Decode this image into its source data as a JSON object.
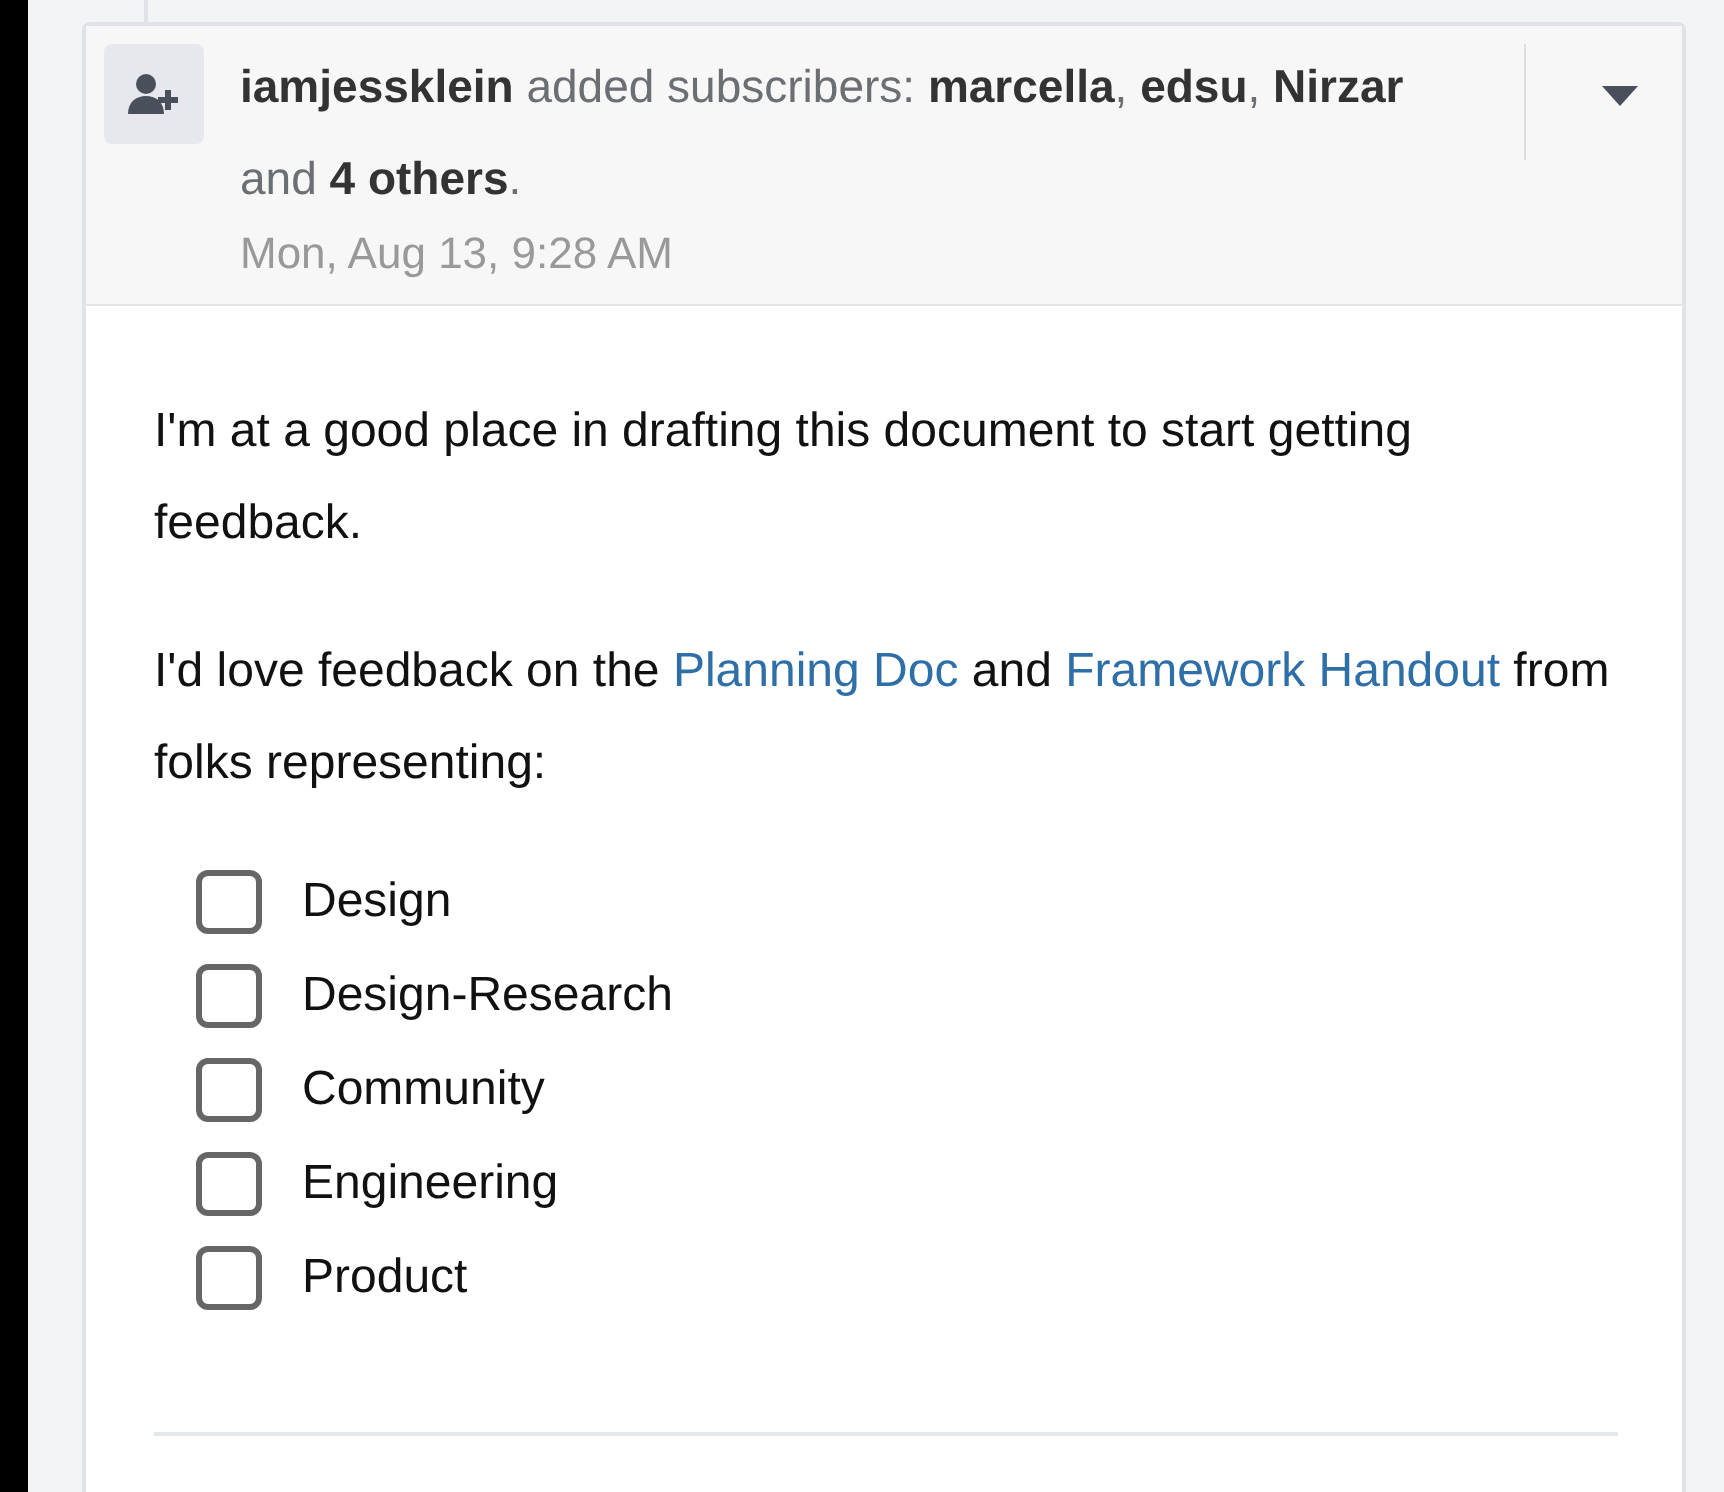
{
  "event": {
    "summary": "**iamjessklein** added subscribers: **marcella**, **edsu**, **Nirzar** and **4 others**.",
    "time": "Mon, Aug 13, 9:28 AM"
  },
  "body": {
    "paragraphs": [
      {
        "parts": [
          {
            "kind": "text",
            "text": "I'm at a good place in drafting this document to start getting feedback."
          }
        ]
      },
      {
        "parts": [
          {
            "kind": "text",
            "text": "I'd love feedback on the "
          },
          {
            "kind": "link",
            "text": "Planning Doc"
          },
          {
            "kind": "text",
            "text": " and "
          },
          {
            "kind": "link",
            "text": "Framework Handout"
          },
          {
            "kind": "text",
            "text": " from folks representing:"
          }
        ]
      }
    ],
    "checklist": [
      {
        "label": "Design",
        "checked": false
      },
      {
        "label": "Design-Research",
        "checked": false
      },
      {
        "label": "Community",
        "checked": false
      },
      {
        "label": "Engineering",
        "checked": false
      },
      {
        "label": "Product",
        "checked": false
      }
    ]
  }
}
